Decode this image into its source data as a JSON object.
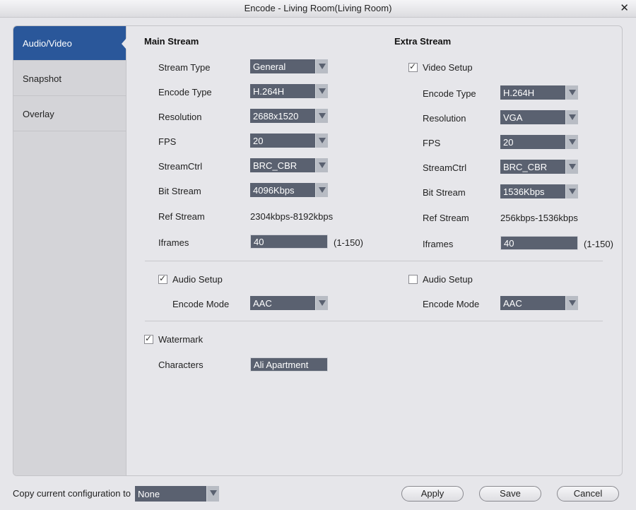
{
  "window": {
    "title": "Encode  - Living Room(Living Room)",
    "close_glyph": "✕"
  },
  "sidebar": {
    "tabs": [
      {
        "label": "Audio/Video",
        "active": true
      },
      {
        "label": "Snapshot",
        "active": false
      },
      {
        "label": "Overlay",
        "active": false
      }
    ]
  },
  "main_stream": {
    "title": "Main Stream",
    "stream_type": {
      "label": "Stream Type",
      "value": "General"
    },
    "encode_type": {
      "label": "Encode Type",
      "value": "H.264H"
    },
    "resolution": {
      "label": "Resolution",
      "value": "2688x1520"
    },
    "fps": {
      "label": "FPS",
      "value": "20"
    },
    "stream_ctrl": {
      "label": "StreamCtrl",
      "value": "BRC_CBR"
    },
    "bit_stream": {
      "label": "Bit Stream",
      "value": "4096Kbps"
    },
    "ref_stream": {
      "label": "Ref Stream",
      "value": "2304kbps-8192kbps"
    },
    "iframes": {
      "label": "Iframes",
      "value": "40",
      "range": "(1-150)"
    },
    "audio_setup": {
      "label": "Audio Setup",
      "checked": true
    },
    "encode_mode": {
      "label": "Encode Mode",
      "value": "AAC"
    }
  },
  "extra_stream": {
    "title": "Extra Stream",
    "video_setup": {
      "label": "Video Setup",
      "checked": true
    },
    "encode_type": {
      "label": "Encode Type",
      "value": "H.264H"
    },
    "resolution": {
      "label": "Resolution",
      "value": "VGA"
    },
    "fps": {
      "label": "FPS",
      "value": "20"
    },
    "stream_ctrl": {
      "label": "StreamCtrl",
      "value": "BRC_CBR"
    },
    "bit_stream": {
      "label": "Bit Stream",
      "value": "1536Kbps"
    },
    "ref_stream": {
      "label": "Ref Stream",
      "value": "256kbps-1536kbps"
    },
    "iframes": {
      "label": "Iframes",
      "value": "40",
      "range": "(1-150)"
    },
    "audio_setup": {
      "label": "Audio Setup",
      "checked": false
    },
    "encode_mode": {
      "label": "Encode Mode",
      "value": "AAC"
    }
  },
  "watermark": {
    "label": "Watermark",
    "checked": true,
    "characters_label": "Characters",
    "characters_value": "Ali Apartment"
  },
  "footer": {
    "copy_label": "Copy current configuration to",
    "copy_value": "None",
    "apply_label": "Apply",
    "save_label": "Save",
    "cancel_label": "Cancel"
  }
}
